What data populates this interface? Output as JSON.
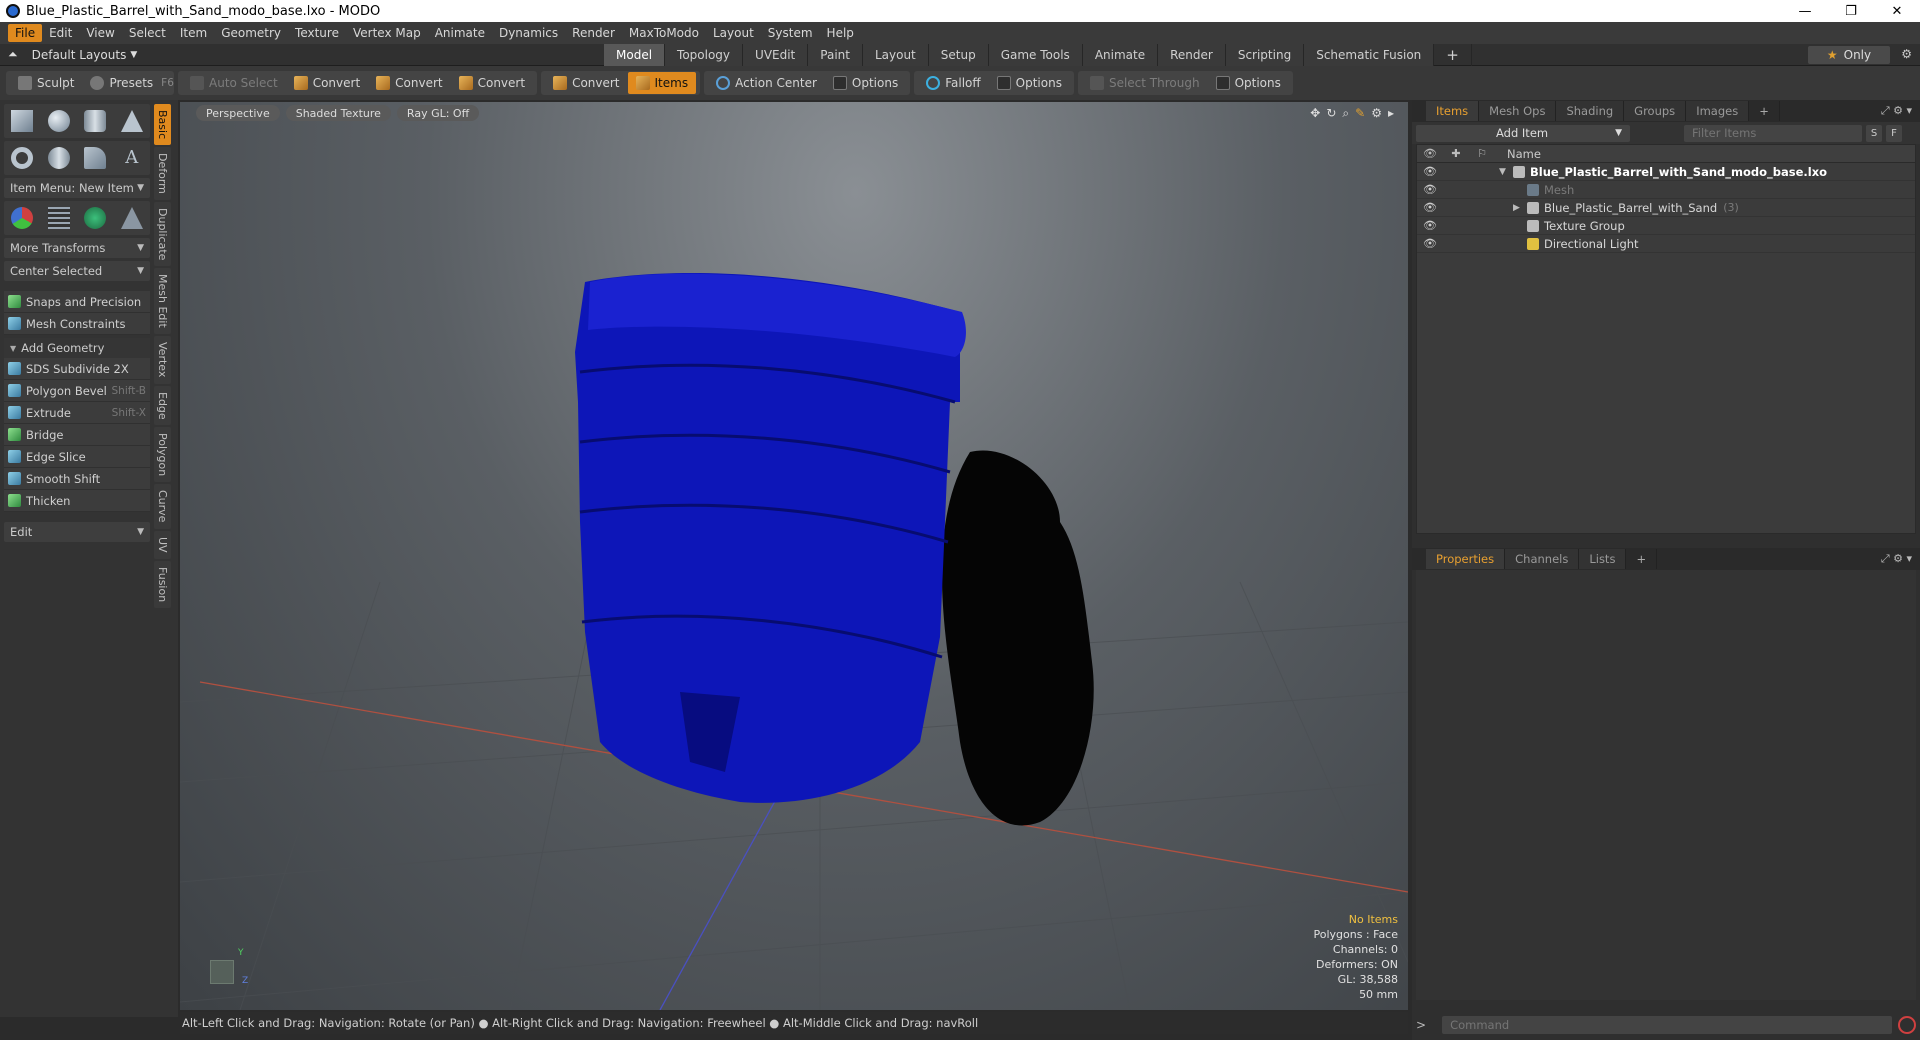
{
  "window": {
    "title": "Blue_Plastic_Barrel_with_Sand_modo_base.lxo - MODO",
    "minimize": "—",
    "restore": "❐",
    "close": "✕"
  },
  "menubar": [
    "File",
    "Edit",
    "View",
    "Select",
    "Item",
    "Geometry",
    "Texture",
    "Vertex Map",
    "Animate",
    "Dynamics",
    "Render",
    "MaxToModo",
    "Layout",
    "System",
    "Help"
  ],
  "layoutbar": {
    "layout_select": "Default Layouts",
    "tabs": [
      "Model",
      "Topology",
      "UVEdit",
      "Paint",
      "Layout",
      "Setup",
      "Game Tools",
      "Animate",
      "Render",
      "Scripting",
      "Schematic Fusion"
    ],
    "active_tab": "Model",
    "only_label": "Only"
  },
  "toolbar": {
    "sculpt": "Sculpt",
    "presets": "Presets",
    "presets_key": "F6",
    "auto_select": "Auto Select",
    "convert1": "Convert",
    "convert2": "Convert",
    "convert3": "Convert",
    "convert4": "Convert",
    "items": "Items",
    "action_center": "Action Center",
    "options1": "Options",
    "falloff": "Falloff",
    "options2": "Options",
    "select_through": "Select Through",
    "options3": "Options"
  },
  "leftpanel": {
    "item_menu": "Item Menu: New Item",
    "more_transforms": "More Transforms",
    "center_selected": "Center Selected",
    "snaps": "Snaps and Precision",
    "mesh_constraints": "Mesh Constraints",
    "add_geometry": "Add Geometry",
    "tools": [
      {
        "label": "SDS Subdivide 2X",
        "key": ""
      },
      {
        "label": "Polygon Bevel",
        "key": "Shift-B"
      },
      {
        "label": "Extrude",
        "key": "Shift-X"
      },
      {
        "label": "Bridge",
        "key": ""
      },
      {
        "label": "Edge Slice",
        "key": ""
      },
      {
        "label": "Smooth Shift",
        "key": ""
      },
      {
        "label": "Thicken",
        "key": ""
      }
    ],
    "edit": "Edit",
    "vtabs": [
      "Basic",
      "Deform",
      "Duplicate",
      "Mesh Edit",
      "Vertex",
      "Edge",
      "Polygon",
      "Curve",
      "UV",
      "Fusion"
    ]
  },
  "viewport": {
    "perspective": "Perspective",
    "shading": "Shaded Texture",
    "raygl": "Ray GL: Off",
    "stats": {
      "no_items": "No Items",
      "polygons": "Polygons : Face",
      "channels": "Channels: 0",
      "deformers": "Deformers: ON",
      "gl": "GL: 38,588",
      "scale": "50 mm"
    },
    "axis_y": "Y",
    "axis_z": "Z",
    "colors": {
      "barrel": "#0d16b8",
      "lid": "#050505"
    }
  },
  "statusbar": "Alt-Left Click and Drag: Navigation: Rotate (or Pan) ● Alt-Right Click and Drag: Navigation: Freewheel ● Alt-Middle Click and Drag: navRoll",
  "rightpanel": {
    "tabs": [
      "Items",
      "Mesh Ops",
      "Shading",
      "Groups",
      "Images"
    ],
    "active_tab": "Items",
    "add_item": "Add Item",
    "filter_placeholder": "Filter Items",
    "btn_s": "S",
    "btn_f": "F",
    "name_header": "Name",
    "rows": [
      {
        "label": "Blue_Plastic_Barrel_with_Sand_modo_base.lxo",
        "count": ""
      },
      {
        "label": "Mesh",
        "count": ""
      },
      {
        "label": "Blue_Plastic_Barrel_with_Sand",
        "count": "(3)"
      },
      {
        "label": "Texture Group",
        "count": ""
      },
      {
        "label": "Directional Light",
        "count": ""
      }
    ],
    "props_tabs": [
      "Properties",
      "Channels",
      "Lists"
    ],
    "command_placeholder": "Command",
    "cmd_prompt": ">"
  }
}
